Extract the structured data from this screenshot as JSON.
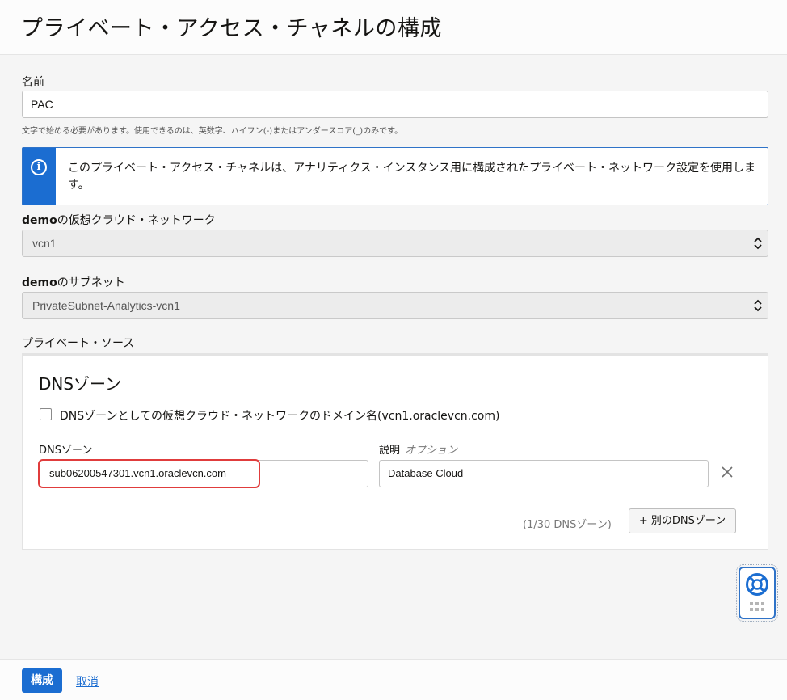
{
  "header": {
    "title": "プライベート・アクセス・チャネルの構成"
  },
  "name_field": {
    "label": "名前",
    "value": "PAC",
    "help": "文字で始める必要があります。使用できるのは、英数字、ハイフン(-)またはアンダースコア(_)のみです。"
  },
  "info": {
    "icon": "info-icon",
    "message": "このプライベート・アクセス・チャネルは、アナリティクス・インスタンス用に構成されたプライベート・ネットワーク設定を使用します。",
    "accent": "#1b6dd1"
  },
  "vcn": {
    "label_bold": "demo",
    "label_rest": "の仮想クラウド・ネットワーク",
    "value": "vcn1"
  },
  "subnet": {
    "label_bold": "demo",
    "label_rest": "のサブネット",
    "value": "PrivateSubnet-Analytics-vcn1"
  },
  "private_source": {
    "label": "プライベート・ソース"
  },
  "dns_panel": {
    "title": "DNSゾーン",
    "checkbox_label": "DNSゾーンとしての仮想クラウド・ネットワークのドメイン名(vcn1.oraclevcn.com)",
    "zone_label": "DNSゾーン",
    "zone_value": "sub06200547301.vcn1.oraclevcn.com",
    "desc_label": "説明",
    "desc_optional": "オプション",
    "desc_value": "Database Cloud",
    "count_text": "(1/30 DNSゾーン)",
    "add_button": "+ 別のDNSゾーン",
    "highlight_color": "#e03c3c"
  },
  "footer": {
    "primary": "構成",
    "cancel": "取消"
  }
}
